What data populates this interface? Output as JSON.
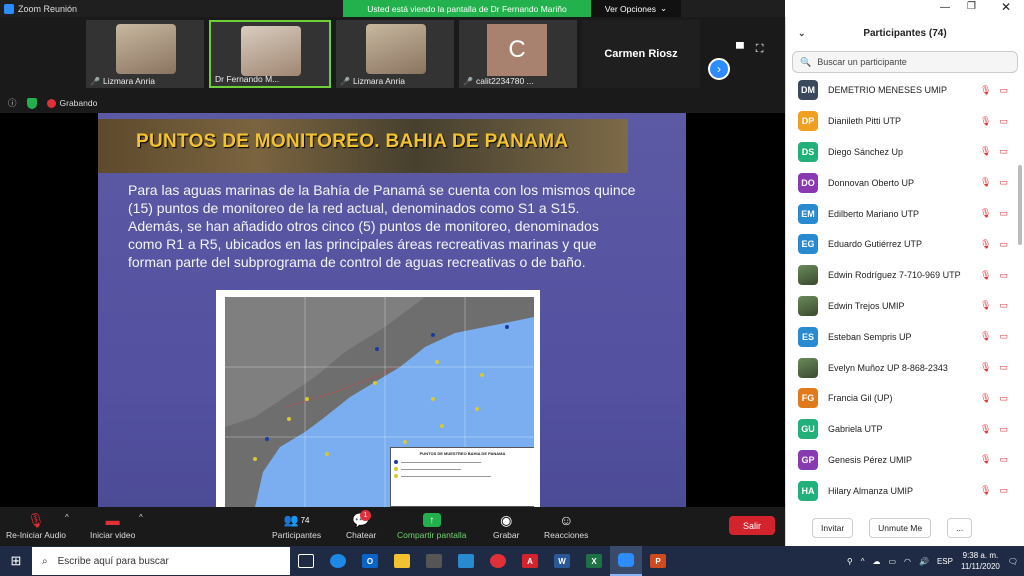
{
  "window": {
    "title": "Zoom Reunión",
    "share_banner": "Usted está viendo la pantalla de Dr Fernando Mariño",
    "view_options": "Ver Opciones"
  },
  "filmstrip": {
    "tiles": [
      {
        "label": "Lizmara Anria"
      },
      {
        "label": "Dr Fernando M..."
      },
      {
        "label": "Lizmara Anria"
      },
      {
        "label": "calit2234780 ...",
        "avatar_letter": "C"
      },
      {
        "label": "Carmen Riosz"
      }
    ]
  },
  "status": {
    "recording": "Grabando"
  },
  "slide": {
    "title": "PUNTOS DE MONITOREO. BAHIA DE PANAMA",
    "body": "Para las aguas marinas de la Bahía de Panamá se cuenta con los mismos quince (15) puntos de monitoreo de la red actual, denominados como S1 a S15. Además, se han añadido otros cinco (5) puntos de monitoreo, denominados como R1 a R5, ubicados en las principales áreas recreativas marinas y que forman parte del subprograma de control de aguas recreativas o de baño.",
    "map_legend_title": "PUNTOS DE MUESTREO BAHIA DE PANAMA"
  },
  "controls": {
    "audio": "Re-Iniciar Audio",
    "video": "Iniciar video",
    "participants": "Participantes",
    "participants_count": "74",
    "chat": "Chatear",
    "chat_badge": "1",
    "share": "Compartir pantalla",
    "record": "Grabar",
    "reactions": "Reacciones",
    "leave": "Salir"
  },
  "participants_panel": {
    "title": "Participantes (74)",
    "search_placeholder": "Buscar un participante",
    "invite": "Invitar",
    "unmute": "Unmute Me",
    "more": "...",
    "list": [
      {
        "initials": "DM",
        "name": "DEMETRIO MENESES UMIP",
        "color": "#3a4a5c"
      },
      {
        "initials": "DP",
        "name": "Dianileth Pitti   UTP",
        "color": "#f0a020"
      },
      {
        "initials": "DS",
        "name": "Diego Sánchez Up",
        "color": "#22b07a"
      },
      {
        "initials": "DO",
        "name": "Donnovan Oberto UP",
        "color": "#8a3ab0"
      },
      {
        "initials": "EM",
        "name": "Edilberto Mariano UTP",
        "color": "#2a8ad0"
      },
      {
        "initials": "EG",
        "name": "Eduardo Gutiérrez UTP",
        "color": "#2a8ad0"
      },
      {
        "initials": "",
        "name": "Edwin Rodríguez 7-710-969 UTP",
        "color": "photo"
      },
      {
        "initials": "",
        "name": "Edwin Trejos UMIP",
        "color": "photo"
      },
      {
        "initials": "ES",
        "name": "Esteban Sempris UP",
        "color": "#2a8ad0"
      },
      {
        "initials": "",
        "name": "Evelyn Muñoz UP 8-868-2343",
        "color": "photo"
      },
      {
        "initials": "FG",
        "name": "Francia Gil (UP)",
        "color": "#e07a1a"
      },
      {
        "initials": "GU",
        "name": "Gabriela UTP",
        "color": "#22b07a"
      },
      {
        "initials": "GP",
        "name": "Genesis Pérez UMIP",
        "color": "#8a3ab0"
      },
      {
        "initials": "HA",
        "name": "Hilary Almanza UMIP",
        "color": "#22b07a"
      }
    ]
  },
  "taskbar": {
    "search_placeholder": "Escribe aquí para buscar",
    "language": "ESP",
    "time": "9:38 a. m.",
    "date": "11/11/2020"
  }
}
